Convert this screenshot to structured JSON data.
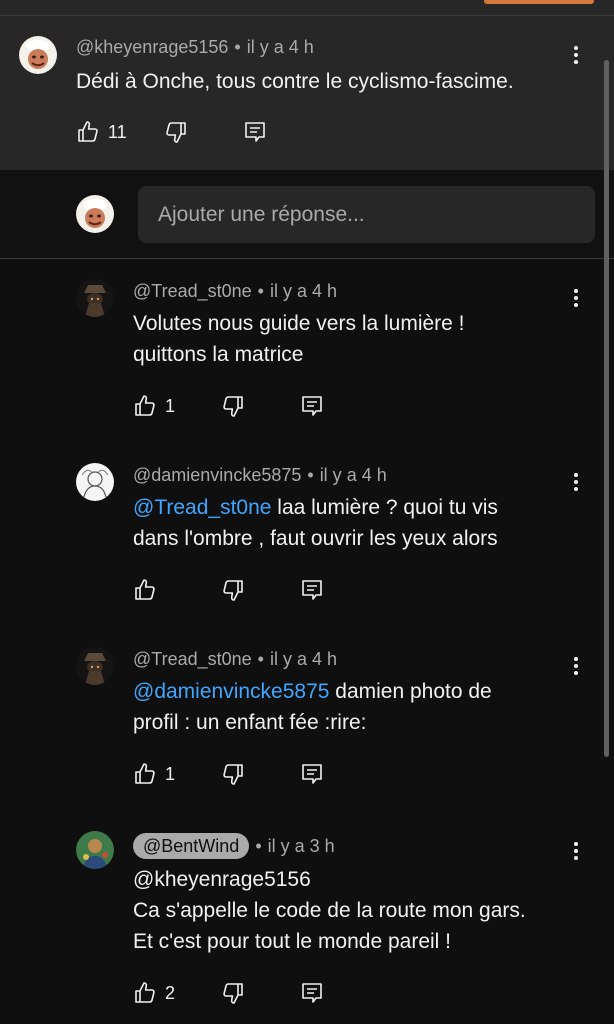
{
  "main_comment": {
    "author": "@kheyenrage5156",
    "time": "il y a 4 h",
    "text": "Dédi à Onche, tous contre le cyclismo-fascime.",
    "likes": "11"
  },
  "reply_box": {
    "placeholder": "Ajouter une réponse..."
  },
  "replies": [
    {
      "author": "@Tread_st0ne",
      "time": "il y a 4 h",
      "line1": "Volutes nous guide vers la lumière !",
      "line2": "quittons la matrice",
      "likes": "1"
    },
    {
      "author": "@damienvincke5875",
      "time": "il y a 4 h",
      "mention": "@Tread_st0ne",
      "line1_rest": " laa lumière ? quoi tu vis",
      "line2": "dans l'ombre , faut ouvrir les yeux alors",
      "likes": ""
    },
    {
      "author": "@Tread_st0ne",
      "time": "il y a 4 h",
      "mention": "@damienvincke5875",
      "line1_rest": " damien photo de",
      "line2": "profil : un enfant fée :rire:",
      "likes": "1"
    },
    {
      "author": "@BentWind",
      "time": "il y a 3 h",
      "line1": "@kheyenrage5156",
      "line2": "Ca s'appelle le code de la route mon gars.",
      "line3": "Et c'est pour tout le monde pareil !",
      "likes": "2"
    }
  ],
  "icons": {
    "like": "thumb-up-icon",
    "dislike": "thumb-down-icon",
    "reply": "comment-icon",
    "menu": "more-vert-icon"
  },
  "colors": {
    "background": "#0f0f0f",
    "main_comment_bg": "#272727",
    "mention": "#3ea6ff",
    "meta_text": "#aaaaaa"
  }
}
